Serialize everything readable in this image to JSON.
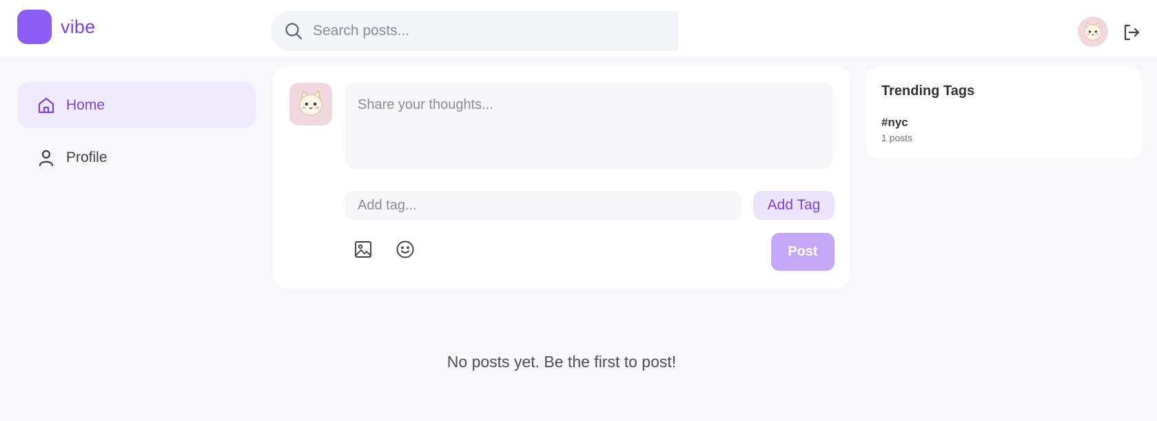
{
  "brand": {
    "name": "vibe",
    "accent": "#8b5cf6"
  },
  "search": {
    "placeholder": "Search posts...",
    "icon": "search-icon"
  },
  "header": {
    "avatar_icon": "cat-avatar-icon",
    "logout_icon": "logout-icon"
  },
  "sidebar": {
    "items": [
      {
        "label": "Home",
        "icon": "home-icon",
        "active": true
      },
      {
        "label": "Profile",
        "icon": "user-icon",
        "active": false
      }
    ]
  },
  "composer": {
    "text_placeholder": "Share your thoughts...",
    "tag_placeholder": "Add tag...",
    "add_tag_label": "Add Tag",
    "post_label": "Post",
    "tools": [
      "image-icon",
      "emoji-icon"
    ]
  },
  "trending": {
    "title": "Trending Tags",
    "tags": [
      {
        "name": "#nyc",
        "count": "1 posts"
      }
    ]
  },
  "feed": {
    "empty_message": "No posts yet. Be the first to post!"
  },
  "colors": {
    "accent_text": "#7e3fe0",
    "active_nav_bg": "#efe9fc",
    "post_button_bg": "#c4a8f7",
    "add_tag_bg": "#ece4fd",
    "page_bg": "#f8f8fb"
  }
}
